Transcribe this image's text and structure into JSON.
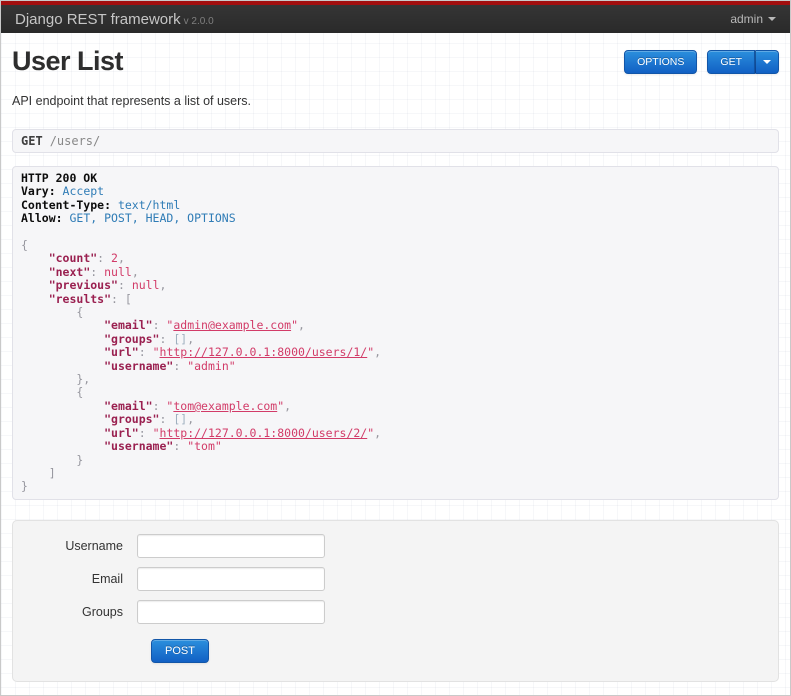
{
  "navbar": {
    "brand": "Django REST framework",
    "version": "v 2.0.0",
    "user": "admin"
  },
  "page": {
    "title": "User List",
    "description": "API endpoint that represents a list of users."
  },
  "actions": {
    "options_label": "OPTIONS",
    "get_label": "GET"
  },
  "request": {
    "method": "GET",
    "path": "/users/"
  },
  "colors": {
    "top_stripe_red": "#a20f0f",
    "navbar_dark": "#2e2e2e",
    "button_blue": "#1b6ed2",
    "code_key": "#9a2050",
    "code_value": "#d23b68",
    "header_value_blue": "#2f7cb6",
    "panel_bg": "#f6f6f8"
  },
  "response": {
    "lines": [
      [
        {
          "c": "h",
          "t": "HTTP 200 OK"
        }
      ],
      [
        {
          "c": "h",
          "t": "Vary:"
        },
        {
          "c": "hv",
          "t": " Accept"
        }
      ],
      [
        {
          "c": "h",
          "t": "Content-Type:"
        },
        {
          "c": "hv",
          "t": " text/html"
        }
      ],
      [
        {
          "c": "h",
          "t": "Allow:"
        },
        {
          "c": "hv",
          "t": " GET, POST, HEAD, OPTIONS"
        }
      ],
      [],
      [
        {
          "c": "p",
          "t": "{"
        }
      ],
      [
        {
          "c": "p",
          "t": "    "
        },
        {
          "c": "k",
          "t": "\"count\""
        },
        {
          "c": "p",
          "t": ": "
        },
        {
          "c": "v",
          "t": "2"
        },
        {
          "c": "p",
          "t": ","
        }
      ],
      [
        {
          "c": "p",
          "t": "    "
        },
        {
          "c": "k",
          "t": "\"next\""
        },
        {
          "c": "p",
          "t": ": "
        },
        {
          "c": "v",
          "t": "null"
        },
        {
          "c": "p",
          "t": ","
        }
      ],
      [
        {
          "c": "p",
          "t": "    "
        },
        {
          "c": "k",
          "t": "\"previous\""
        },
        {
          "c": "p",
          "t": ": "
        },
        {
          "c": "v",
          "t": "null"
        },
        {
          "c": "p",
          "t": ","
        }
      ],
      [
        {
          "c": "p",
          "t": "    "
        },
        {
          "c": "k",
          "t": "\"results\""
        },
        {
          "c": "p",
          "t": ": ["
        }
      ],
      [
        {
          "c": "p",
          "t": "        {"
        }
      ],
      [
        {
          "c": "p",
          "t": "            "
        },
        {
          "c": "k",
          "t": "\"email\""
        },
        {
          "c": "p",
          "t": ": "
        },
        {
          "c": "v",
          "t": "\""
        },
        {
          "c": "a",
          "t": "admin@example.com"
        },
        {
          "c": "v",
          "t": "\""
        },
        {
          "c": "p",
          "t": ","
        }
      ],
      [
        {
          "c": "p",
          "t": "            "
        },
        {
          "c": "k",
          "t": "\"groups\""
        },
        {
          "c": "p",
          "t": ": "
        },
        {
          "c": "g",
          "t": "[]"
        },
        {
          "c": "p",
          "t": ","
        }
      ],
      [
        {
          "c": "p",
          "t": "            "
        },
        {
          "c": "k",
          "t": "\"url\""
        },
        {
          "c": "p",
          "t": ": "
        },
        {
          "c": "v",
          "t": "\""
        },
        {
          "c": "a",
          "t": "http://127.0.0.1:8000/users/1/"
        },
        {
          "c": "v",
          "t": "\""
        },
        {
          "c": "p",
          "t": ","
        }
      ],
      [
        {
          "c": "p",
          "t": "            "
        },
        {
          "c": "k",
          "t": "\"username\""
        },
        {
          "c": "p",
          "t": ": "
        },
        {
          "c": "v",
          "t": "\"admin\""
        }
      ],
      [
        {
          "c": "p",
          "t": "        },"
        }
      ],
      [
        {
          "c": "p",
          "t": "        {"
        }
      ],
      [
        {
          "c": "p",
          "t": "            "
        },
        {
          "c": "k",
          "t": "\"email\""
        },
        {
          "c": "p",
          "t": ": "
        },
        {
          "c": "v",
          "t": "\""
        },
        {
          "c": "a",
          "t": "tom@example.com"
        },
        {
          "c": "v",
          "t": "\""
        },
        {
          "c": "p",
          "t": ","
        }
      ],
      [
        {
          "c": "p",
          "t": "            "
        },
        {
          "c": "k",
          "t": "\"groups\""
        },
        {
          "c": "p",
          "t": ": "
        },
        {
          "c": "g",
          "t": "[]"
        },
        {
          "c": "p",
          "t": ","
        }
      ],
      [
        {
          "c": "p",
          "t": "            "
        },
        {
          "c": "k",
          "t": "\"url\""
        },
        {
          "c": "p",
          "t": ": "
        },
        {
          "c": "v",
          "t": "\""
        },
        {
          "c": "a",
          "t": "http://127.0.0.1:8000/users/2/"
        },
        {
          "c": "v",
          "t": "\""
        },
        {
          "c": "p",
          "t": ","
        }
      ],
      [
        {
          "c": "p",
          "t": "            "
        },
        {
          "c": "k",
          "t": "\"username\""
        },
        {
          "c": "p",
          "t": ": "
        },
        {
          "c": "v",
          "t": "\"tom\""
        }
      ],
      [
        {
          "c": "p",
          "t": "        }"
        }
      ],
      [
        {
          "c": "p",
          "t": "    ]"
        }
      ],
      [
        {
          "c": "p",
          "t": "}"
        }
      ]
    ]
  },
  "form": {
    "fields": [
      {
        "label": "Username",
        "value": ""
      },
      {
        "label": "Email",
        "value": ""
      },
      {
        "label": "Groups",
        "value": ""
      }
    ],
    "submit_label": "POST"
  }
}
